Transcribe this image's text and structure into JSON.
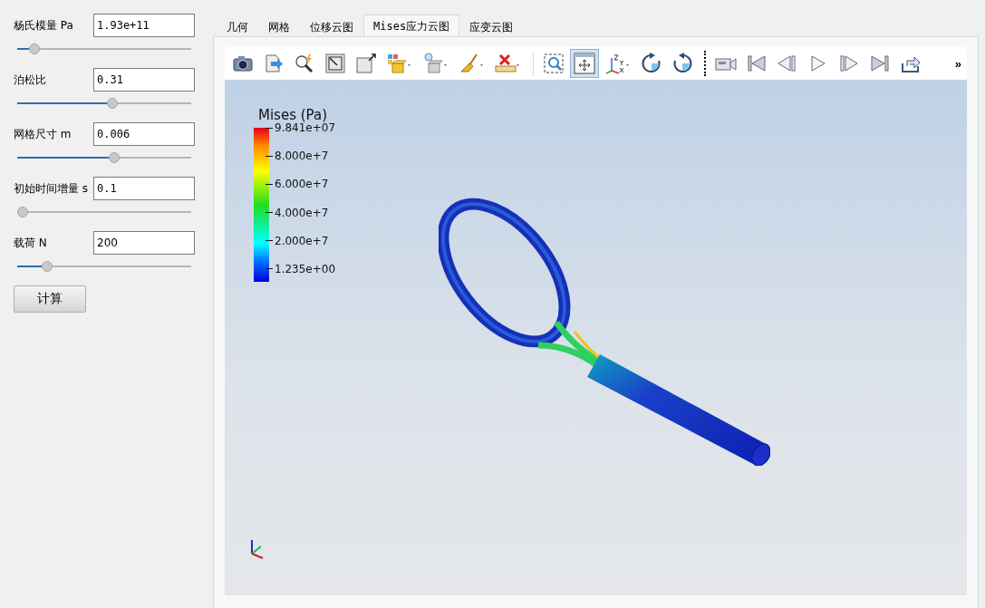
{
  "parameters": [
    {
      "label": "杨氏模量 Pa",
      "value": "1.93e+11",
      "mono": true,
      "level": 0.07
    },
    {
      "label": "泊松比",
      "value": "0.31",
      "mono": true,
      "level": 0.55
    },
    {
      "label": "网格尺寸 m",
      "value": "0.006",
      "mono": true,
      "level": 0.56
    },
    {
      "label": "初始时间增量 s",
      "value": "0.1",
      "mono": true,
      "level": 0
    },
    {
      "label": "载荷 N",
      "value": "200",
      "mono": false,
      "level": 0.15
    }
  ],
  "compute_button": "计算",
  "tabs": [
    {
      "label": "几何",
      "selected": false
    },
    {
      "label": "网格",
      "selected": false
    },
    {
      "label": "位移云图",
      "selected": false
    },
    {
      "label": "Mises应力云图",
      "selected": true
    },
    {
      "label": "应变云图",
      "selected": false
    }
  ],
  "toolbar": {
    "buttons": [
      {
        "kind": "camera",
        "selected": false
      },
      {
        "kind": "export",
        "selected": false
      },
      {
        "kind": "zoom-data",
        "selected": false
      },
      {
        "kind": "reset-frame",
        "selected": false
      },
      {
        "kind": "frame-arrow",
        "selected": false
      },
      {
        "kind": "color-cube",
        "selected": false
      },
      {
        "kind": "light-cube",
        "selected": false
      },
      {
        "kind": "brush",
        "selected": false
      },
      {
        "kind": "ruler",
        "selected": false
      },
      {
        "kind": "separator"
      },
      {
        "kind": "zoom-box",
        "selected": false
      },
      {
        "kind": "pan",
        "selected": true
      },
      {
        "kind": "axes",
        "selected": false
      },
      {
        "kind": "rotate-cw",
        "selected": false
      },
      {
        "kind": "rotate-ccw",
        "selected": false
      },
      {
        "kind": "dotted-separator"
      },
      {
        "kind": "video-camera",
        "selected": false
      },
      {
        "kind": "first-frame",
        "selected": false
      },
      {
        "kind": "previous-frame",
        "selected": false
      },
      {
        "kind": "play",
        "selected": false
      },
      {
        "kind": "next-frame",
        "selected": false
      },
      {
        "kind": "last-frame",
        "selected": false
      },
      {
        "kind": "loop",
        "selected": false
      }
    ],
    "overflow": "»"
  },
  "legend": {
    "title": "Mises (Pa)",
    "labels": [
      "9.841e+07",
      "8.000e+7",
      "6.000e+7",
      "4.000e+7",
      "2.000e+7",
      "1.235e+00"
    ]
  }
}
